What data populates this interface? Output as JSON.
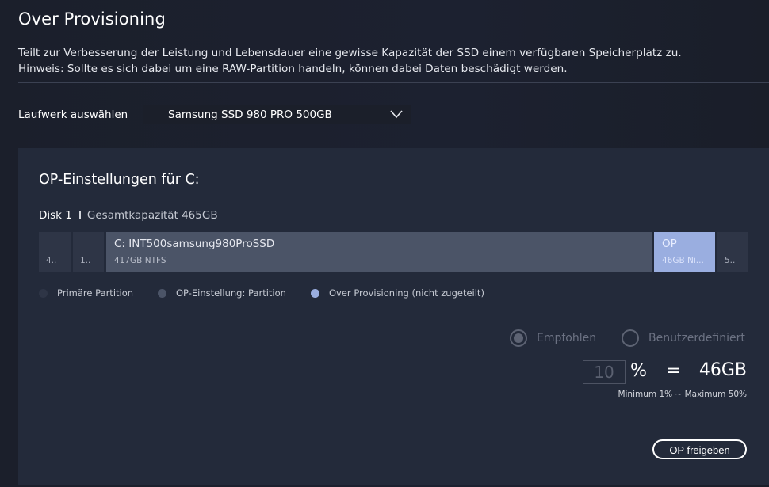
{
  "header": {
    "title": "Over Provisioning",
    "description_line1": "Teilt zur Verbesserung der Leistung und Lebensdauer eine gewisse Kapazität der SSD einem verfügbaren Speicherplatz zu.",
    "description_line2": "Hinweis: Sollte es sich dabei um eine RAW-Partition handeln, können dabei Daten beschädigt werden."
  },
  "drive_select": {
    "label": "Laufwerk auswählen",
    "value": "Samsung SSD 980 PRO 500GB",
    "icon": "chevron-down-icon"
  },
  "op_panel": {
    "title": "OP-Einstellungen für  C:",
    "disk_name": "Disk 1",
    "disk_capacity": "Gesamtkapazität 465GB",
    "partitions": [
      {
        "label": "4..",
        "type": "primary"
      },
      {
        "label": "1..",
        "type": "primary"
      },
      {
        "name": "C: INT500samsung980ProSSD",
        "detail": "417GB NTFS",
        "type": "op-partition"
      },
      {
        "name": "OP",
        "detail": "46GB Ni...",
        "type": "over-provisioning"
      },
      {
        "label": "5..",
        "type": "primary"
      }
    ],
    "legend": [
      {
        "label": "Primäre Partition",
        "color": "#2e3546"
      },
      {
        "label": "OP-Einstellung: Partition",
        "color": "#4b5467"
      },
      {
        "label": "Over Provisioning (nicht zugeteilt)",
        "color": "#9aaee0"
      }
    ],
    "mode": {
      "recommended_label": "Empfohlen",
      "custom_label": "Benutzerdefiniert",
      "selected": "recommended"
    },
    "percent_value": "10",
    "percent_sign": "%",
    "equals": "=",
    "size_result": "46GB",
    "range_hint": "Minimum 1% ~ Maximum 50%",
    "release_button": "OP freigeben"
  }
}
